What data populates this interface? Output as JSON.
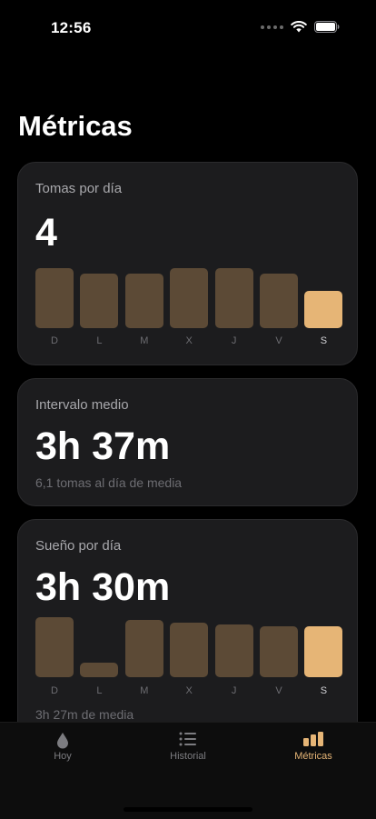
{
  "status_bar": {
    "time": "12:56"
  },
  "page_title": "Métricas",
  "colors": {
    "accent": "#e6b576",
    "bar_inactive": "#5c4a36",
    "card_bg": "#1c1c1e"
  },
  "cards": [
    {
      "label": "Tomas por día",
      "value": "4",
      "chart": {
        "type": "bar",
        "categories": [
          "D",
          "L",
          "M",
          "X",
          "J",
          "V",
          "S"
        ],
        "values": [
          6.4,
          5.8,
          5.8,
          6.4,
          6.4,
          5.8,
          4
        ],
        "highlight_index": 6
      }
    },
    {
      "label": "Intervalo medio",
      "value": "3h 37m",
      "note": "6,1 tomas al día de media"
    },
    {
      "label": "Sueño por día",
      "value": "3h 30m",
      "chart": {
        "type": "bar",
        "categories": [
          "D",
          "L",
          "M",
          "X",
          "J",
          "V",
          "S"
        ],
        "values": [
          4.1,
          1,
          3.9,
          3.7,
          3.6,
          3.5,
          3.5
        ],
        "highlight_index": 6
      },
      "note": "3h 27m de media"
    }
  ],
  "tab_bar": {
    "tabs": [
      {
        "label": "Hoy",
        "icon": "drop-icon"
      },
      {
        "label": "Historial",
        "icon": "list-icon"
      },
      {
        "label": "Métricas",
        "icon": "bar-chart-icon",
        "active": true
      }
    ]
  }
}
